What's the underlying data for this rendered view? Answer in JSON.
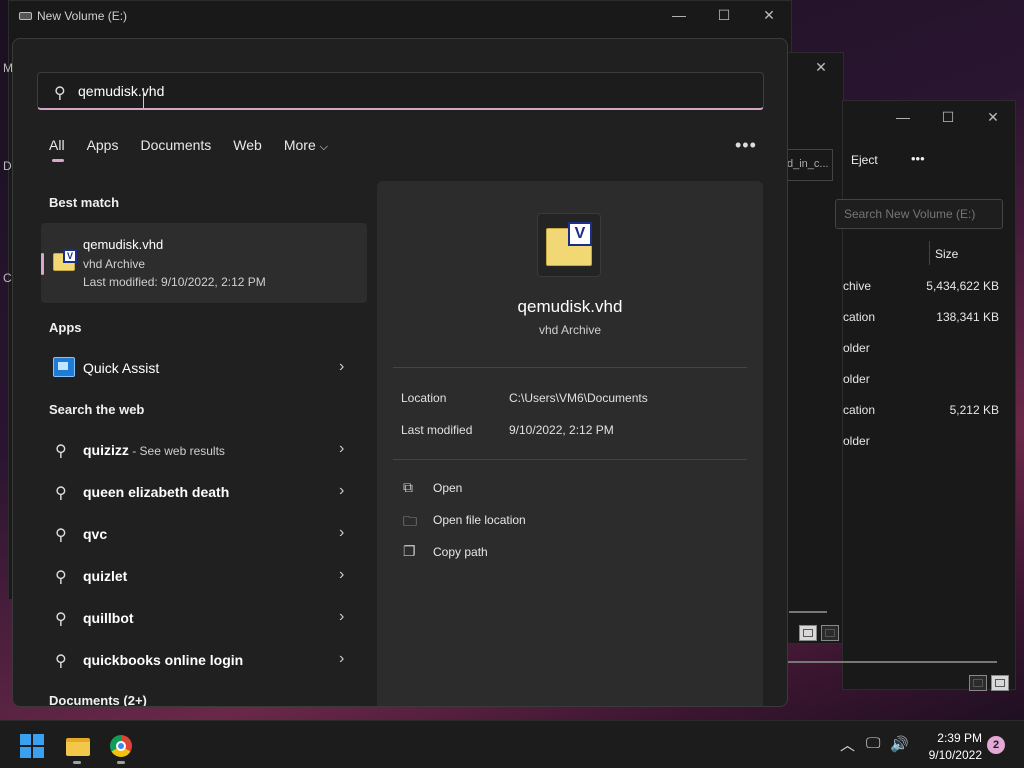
{
  "explorer_main": {
    "title": "New Volume (E:)",
    "minimize": "—",
    "maximize": "☐",
    "close": "✕",
    "side_letters": [
      "M",
      "D",
      "C"
    ]
  },
  "explorer_mid": {
    "close": "✕",
    "crumb": "d_in_c..."
  },
  "explorer_right": {
    "minimize": "—",
    "maximize": "☐",
    "close": "✕",
    "eject": "Eject",
    "more": "•••",
    "search_placeholder": "Search New Volume (E:)",
    "size_header": "Size",
    "rows": [
      {
        "type": "chive",
        "size": "5,434,622 KB"
      },
      {
        "type": "cation",
        "size": "138,341 KB"
      },
      {
        "type": "older",
        "size": ""
      },
      {
        "type": "older",
        "size": ""
      },
      {
        "type": "cation",
        "size": "5,212 KB"
      },
      {
        "type": "older",
        "size": ""
      }
    ]
  },
  "search": {
    "query": "qemudisk.vhd",
    "icon": "search-icon",
    "tabs": [
      "All",
      "Apps",
      "Documents",
      "Web",
      "More"
    ],
    "more_chevron": "⌵",
    "more_options": "•••",
    "best_match": {
      "section": "Best match",
      "name": "qemudisk.vhd",
      "type": "vhd Archive",
      "modified": "Last modified: 9/10/2022, 2:12 PM",
      "icon_letter": "V"
    },
    "apps": {
      "section": "Apps",
      "items": [
        {
          "label": "Quick Assist",
          "icon": "quick-assist-icon"
        }
      ]
    },
    "web": {
      "section": "Search the web",
      "items": [
        {
          "label": "quizizz",
          "hint": " - See web results"
        },
        {
          "label": "queen elizabeth death",
          "hint": ""
        },
        {
          "label": "qvc",
          "hint": ""
        },
        {
          "label": "quizlet",
          "hint": ""
        },
        {
          "label": "quillbot",
          "hint": ""
        },
        {
          "label": "quickbooks online login",
          "hint": ""
        }
      ]
    },
    "documents": {
      "section": "Documents (2+)"
    },
    "detail": {
      "name": "qemudisk.vhd",
      "type": "vhd Archive",
      "location_label": "Location",
      "location_value": "C:\\Users\\VM6\\Documents",
      "modified_label": "Last modified",
      "modified_value": "9/10/2022, 2:12 PM",
      "actions": [
        {
          "label": "Open",
          "icon": "open-external-icon",
          "glyph": "⧉"
        },
        {
          "label": "Open file location",
          "icon": "folder-icon",
          "glyph": "🗀"
        },
        {
          "label": "Copy path",
          "icon": "copy-icon",
          "glyph": "❐"
        }
      ]
    }
  },
  "taskbar": {
    "time": "2:39 PM",
    "date": "9/10/2022",
    "notifications": "2",
    "chevron": "︿",
    "network": "🖵",
    "volume": "🔊"
  },
  "colors": {
    "accent": "#d9a6cd",
    "panel": "#202020",
    "detail_pane": "#2c2c2c"
  }
}
